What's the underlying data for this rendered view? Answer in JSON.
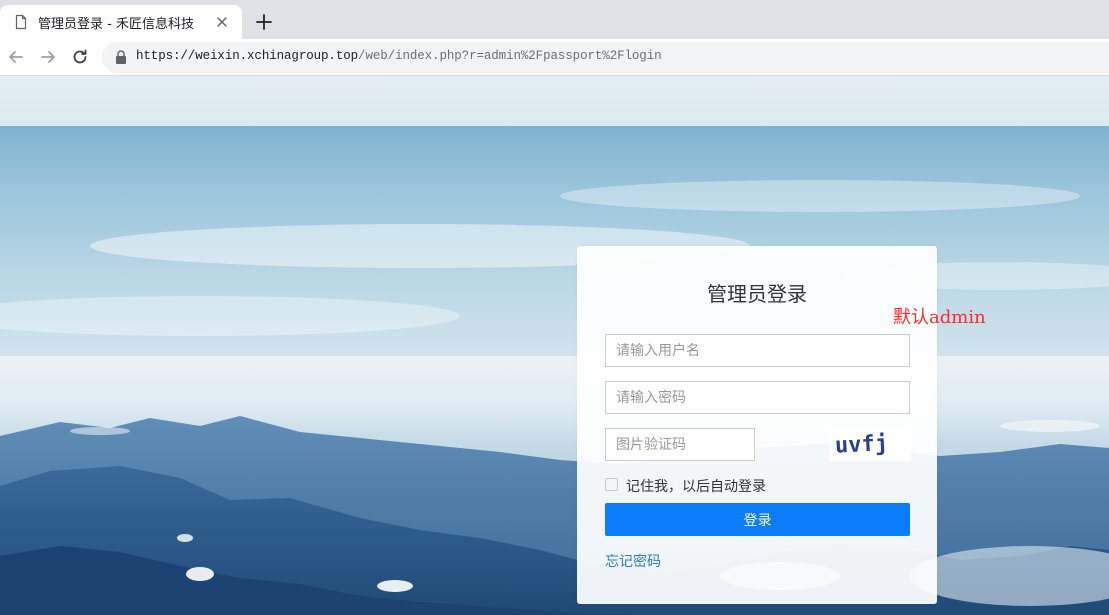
{
  "browser": {
    "tab_title": "管理员登录 - 禾匠信息科技",
    "url_host": "https://weixin.xchinagroup.top",
    "url_path": "/web/index.php?r=admin%2Fpassport%2Flogin"
  },
  "login": {
    "title": "管理员登录",
    "username_placeholder": "请输入用户名",
    "password_placeholder": "请输入密码",
    "captcha_placeholder": "图片验证码",
    "captcha_text": "uvfj",
    "remember_label": "记住我，以后自动登录",
    "submit_label": "登录",
    "forgot_label": "忘记密码"
  },
  "annotation": {
    "note": "默认admin"
  },
  "colors": {
    "primary": "#0a7cfc",
    "link": "#2b7bd6",
    "annotation": "#ff2a2a",
    "captcha_text": "#2a3f8f"
  }
}
